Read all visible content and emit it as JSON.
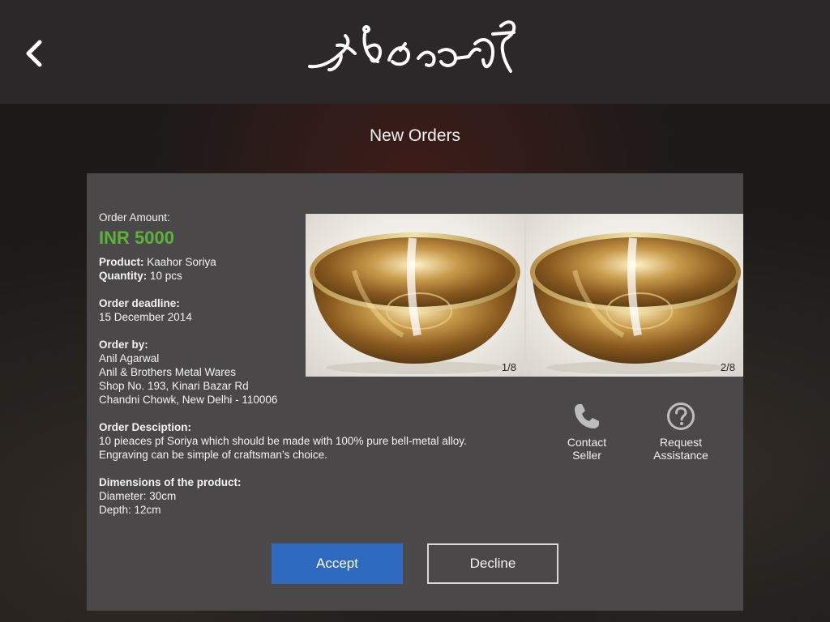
{
  "header": {
    "back_icon": "chevron-left-icon",
    "logo_text": "কাঁহৰ শৰাই"
  },
  "page": {
    "title": "New Orders"
  },
  "order": {
    "amount_label": "Order Amount:",
    "amount_value": "INR 5000",
    "product_label": "Product:",
    "product_value": "Kaahor Soriya",
    "quantity_label": "Quantity:",
    "quantity_value": "10 pcs",
    "deadline_label": "Order deadline:",
    "deadline_value": "15 December 2014",
    "order_by_label": "Order by:",
    "order_by_lines": [
      "Anil Agarwal",
      "Anil & Brothers Metal Wares",
      "Shop No. 193, Kinari Bazar Rd",
      "Chandni Chowk, New Delhi - 110006"
    ],
    "description_label": "Order Desciption:",
    "description_lines": [
      "10 pieaces pf Soriya which should be made with 100% pure bell-metal alloy.",
      "Engraving can be simple of craftsman’s choice."
    ],
    "dimensions_label": "Dimensions of the product:",
    "dimensions_lines": [
      "Diameter: 30cm",
      "Depth: 12cm"
    ]
  },
  "gallery": {
    "photos": [
      {
        "indicator": "1/8",
        "alt": "bell-metal bowl photo"
      },
      {
        "indicator": "2/8",
        "alt": "bell-metal bowl photo"
      }
    ]
  },
  "actions": {
    "contact": {
      "line1": "Contact",
      "line2": "Seller",
      "icon": "phone-icon"
    },
    "assist": {
      "line1": "Request",
      "line2": "Assistance",
      "icon": "question-circle-icon"
    }
  },
  "buttons": {
    "accept": "Accept",
    "decline": "Decline"
  },
  "colors": {
    "accent_green": "#5db33a",
    "accept_blue": "#2e6bc0",
    "panel": "#4a4848",
    "header": "#2a2828"
  }
}
